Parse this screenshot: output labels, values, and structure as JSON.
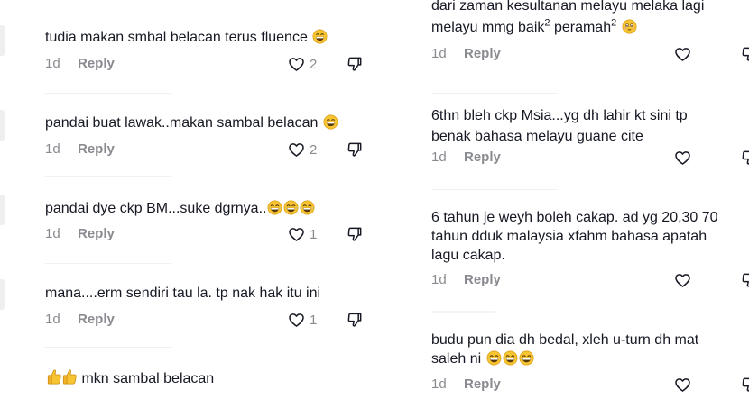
{
  "labels": {
    "reply": "Reply"
  },
  "left_comments": [
    {
      "text": "tudia makan smbal belacan terus fluence",
      "emoji": "grin",
      "time": "1d",
      "likes": "2"
    },
    {
      "text": "pandai buat lawak..makan sambal belacan",
      "emoji": "grin",
      "time": "1d",
      "likes": "2"
    },
    {
      "text": "pandai dye ckp BM...suke dgrnya..",
      "emoji": "laugh-3",
      "time": "1d",
      "likes": "1"
    },
    {
      "text": "mana....erm sendiri tau la. tp nak hak itu ini",
      "emoji": "",
      "time": "1d",
      "likes": "1"
    },
    {
      "text": "mkn sambal belacan",
      "emoji": "thumbs-up-2",
      "time": "",
      "likes": ""
    }
  ],
  "right_comments": [
    {
      "line1": "dari zaman kesultanan melayu melaka lagi",
      "line2": "melayu mmg baik",
      "sup1": "2",
      "mid": " peramah",
      "sup2": "2",
      "emoji": "flushed",
      "time": "1d"
    },
    {
      "line1": "6thn bleh ckp Msia...yg dh lahir kt sini tp",
      "line2": "benak bahasa melayu guane cite",
      "time": "1d"
    },
    {
      "line1": "6 tahun je weyh boleh cakap. ad yg 20,30 70",
      "line2": "tahun dduk malaysia xfahm bahasa apatah",
      "line3": "lagu cakap.",
      "time": "1d"
    },
    {
      "line1": "budu pun dia dh bedal, xleh u-turn dh mat",
      "line2": "saleh ni",
      "emoji": "laugh-3",
      "time": "1d"
    }
  ],
  "colors": {
    "text": "#161823",
    "muted": "#8a8b91",
    "emoji_face": "#f7c531"
  }
}
